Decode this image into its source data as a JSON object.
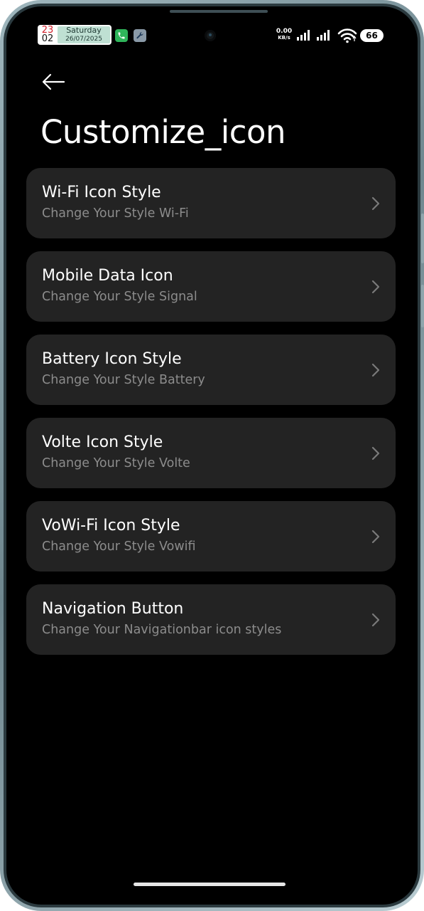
{
  "status_bar": {
    "clock_hour": "23",
    "clock_minute": "02",
    "day": "Saturday",
    "date": "26/07/2025",
    "net_speed_value": "0.00",
    "net_speed_unit": "KB/s",
    "battery_level": "66",
    "icons": [
      "phone-icon",
      "wrench-icon",
      "signal-icon",
      "signal-icon",
      "wifi-icon",
      "battery-icon"
    ]
  },
  "header": {
    "back_icon": "arrow-left-icon",
    "title": "Customize_icon"
  },
  "items": [
    {
      "title": "Wi-Fi Icon Style",
      "subtitle": "Change Your Style Wi-Fi"
    },
    {
      "title": "Mobile Data Icon",
      "subtitle": "Change Your Style Signal"
    },
    {
      "title": "Battery Icon Style",
      "subtitle": "Change Your Style Battery"
    },
    {
      "title": "Volte Icon Style",
      "subtitle": "Change Your Style Volte"
    },
    {
      "title": "VoWi-Fi Icon Style",
      "subtitle": "Change Your Style Vowifi"
    },
    {
      "title": "Navigation Button",
      "subtitle": "Change Your Navigationbar icon styles"
    }
  ],
  "colors": {
    "background": "#000000",
    "card": "#232323",
    "title_text": "#ffffff",
    "subtitle_text": "#8c8c8c",
    "device_frame": "#8fa5ac"
  }
}
